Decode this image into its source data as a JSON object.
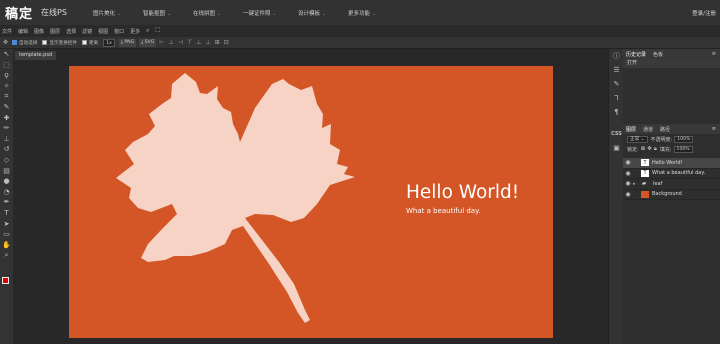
{
  "app": {
    "logo": "稿定",
    "name": "在线PS"
  },
  "topnav": [
    {
      "label": "图片美化"
    },
    {
      "label": "智能抠图"
    },
    {
      "label": "在线拼图"
    },
    {
      "label": "一键证件照"
    },
    {
      "label": "设计模板"
    },
    {
      "label": "更多功能"
    }
  ],
  "login_label": "登录/注册",
  "menus": [
    "文件",
    "编辑",
    "图像",
    "图层",
    "选择",
    "滤镜",
    "视图",
    "窗口",
    "更多"
  ],
  "options": {
    "auto_select": "自动选择",
    "show_transform": "显示变换控件",
    "distance": "距离",
    "scale": "1x",
    "export_png": "PNG",
    "export_svg": "SVG"
  },
  "document_tab": "template.psd",
  "canvas": {
    "bg_color": "#d45525",
    "title": "Hello World!",
    "subtitle": "What a beautiful day."
  },
  "history_panel": {
    "tabs": [
      "历史记录",
      "色板"
    ],
    "items": [
      "打开"
    ]
  },
  "layers_panel": {
    "tabs": [
      "图层",
      "通道",
      "路径"
    ],
    "blend_mode": "正常",
    "opacity_label": "不透明度:",
    "opacity_value": "100%",
    "lock_label": "锁定:",
    "fill_label": "填充:",
    "fill_value": "100%",
    "layers": [
      {
        "name": "Hello World!",
        "icon": "text-layer-icon"
      },
      {
        "name": "What a beautiful day.",
        "icon": "text-layer-icon"
      },
      {
        "name": "leaf",
        "icon": "folder-icon"
      },
      {
        "name": "Background",
        "icon": "image-layer-icon"
      }
    ]
  },
  "colors": {
    "foreground": "#e00000",
    "background": "#ffffff",
    "leaf": "#f6d3c4"
  }
}
